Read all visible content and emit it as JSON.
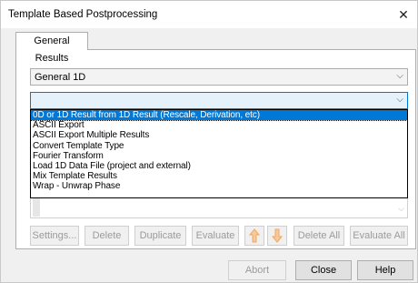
{
  "window": {
    "title": "Template Based Postprocessing",
    "close_glyph": "✕"
  },
  "tabs": [
    {
      "label": "General Results"
    }
  ],
  "category_combo": {
    "value": "General 1D",
    "arrow": "⌵"
  },
  "template_combo": {
    "value": "",
    "arrow": "⌵"
  },
  "dropdown_items": [
    {
      "label": "0D or 1D Result from 1D Result (Rescale, Derivation, etc)",
      "selected": true
    },
    {
      "label": "ASCII Export",
      "selected": false
    },
    {
      "label": "ASCII Export Multiple Results",
      "selected": false
    },
    {
      "label": "Convert Template Type",
      "selected": false
    },
    {
      "label": "Fourier Transform",
      "selected": false
    },
    {
      "label": "Load 1D Data File (project and external)",
      "selected": false
    },
    {
      "label": "Mix Template Results",
      "selected": false
    },
    {
      "label": "Wrap - Unwrap Phase",
      "selected": false
    }
  ],
  "list_scroll_arrow": "⌵",
  "action_buttons": {
    "settings": "Settings...",
    "delete": "Delete",
    "duplicate": "Duplicate",
    "evaluate": "Evaluate",
    "move_up_icon": "arrow-up-icon",
    "move_down_icon": "arrow-down-icon",
    "delete_all": "Delete All",
    "evaluate_all": "Evaluate All"
  },
  "footer_buttons": {
    "abort": "Abort",
    "close": "Close",
    "help": "Help"
  },
  "colors": {
    "selection": "#0078d7",
    "arrow_buttons": "#f5b370"
  }
}
